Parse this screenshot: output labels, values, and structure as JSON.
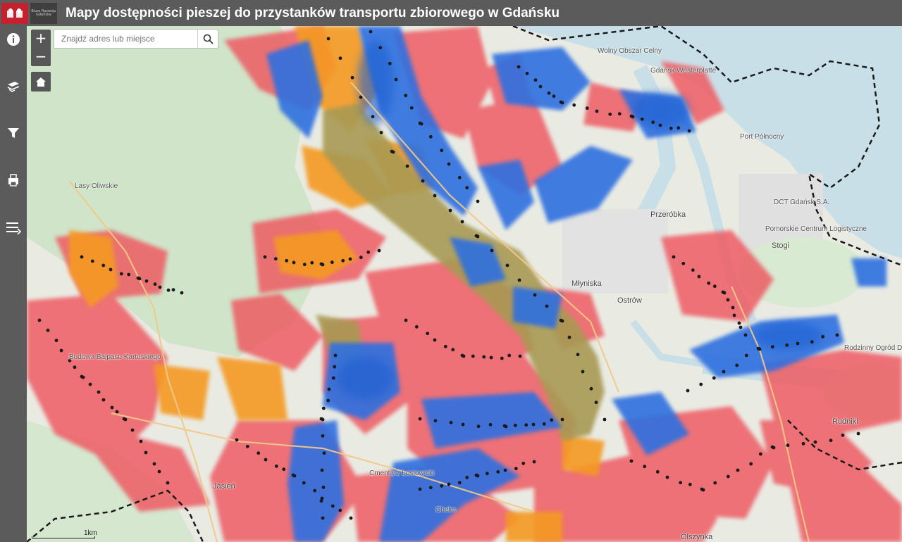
{
  "header": {
    "title": "Mapy dostępności pieszej do przystanków transportu zbiorowego w Gdańsku",
    "logo_text": "Biuro Rozwoju Gdańska"
  },
  "sidebar": {
    "items": [
      {
        "icon": "info-icon"
      },
      {
        "icon": "layers-icon"
      },
      {
        "icon": "filter-icon"
      },
      {
        "icon": "print-icon"
      },
      {
        "icon": "menu-list-icon"
      }
    ]
  },
  "map_controls": {
    "zoom_in": "+",
    "zoom_out": "−",
    "home_icon": "home-icon"
  },
  "search": {
    "placeholder": "Znajdź adres lub miejsce",
    "icon": "search-icon"
  },
  "scale": {
    "label": "1km"
  },
  "places": [
    "Wolny Obszar Celny",
    "Port Północny",
    "DCT Gdańsk S.A.",
    "Pomorskie Centrum Logistyczne",
    "Przeróbka",
    "Stogi",
    "Młyniska",
    "Ostrów",
    "Rudniki",
    "Jasień",
    "Olszynka",
    "Chełm",
    "Gdańsk Westerplatte",
    "Cmentarz Łostowicki",
    "Lasy Oliwskie",
    "Rodzinny Ogród Działkowy",
    "Budowa Bajpasu Kartuskiego"
  ],
  "colors": {
    "header_bg": "#5b5b5b",
    "water": "#c9dfe8",
    "forest": "#cfe4c8",
    "urban": "#ececec",
    "walk_red": "#ee5b64",
    "walk_blue": "#2e6fe0",
    "walk_orange": "#f59a23",
    "walk_olive": "#a89a52",
    "city_boundary": "#1a1a1a"
  }
}
